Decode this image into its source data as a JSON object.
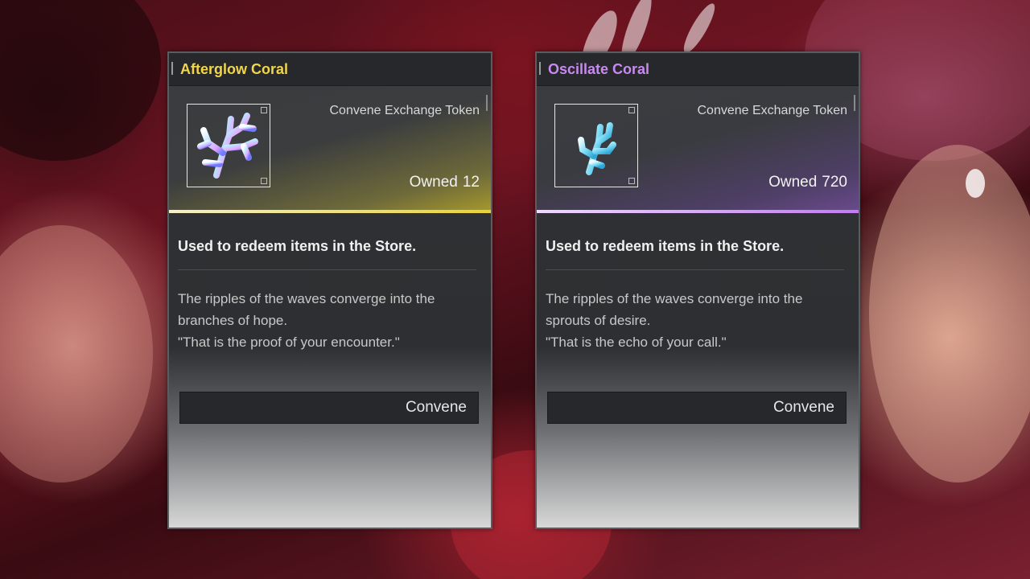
{
  "cards": [
    {
      "title": "Afterglow Coral",
      "title_color": "#f2d64a",
      "accent_color": "#e8d23a",
      "token_label": "Convene Exchange Token",
      "owned_label": "Owned",
      "owned_count": "12",
      "summary": "Used to redeem items in the Store.",
      "lore": [
        "The ripples of the waves converge into the",
        "branches of hope.",
        "\"That is the proof of your encounter.\""
      ],
      "button_label": "Convene",
      "icon": "afterglow-coral-icon"
    },
    {
      "title": "Oscillate Coral",
      "title_color": "#c98af0",
      "accent_color": "#c27cf0",
      "token_label": "Convene Exchange Token",
      "owned_label": "Owned",
      "owned_count": "720",
      "summary": "Used to redeem items in the Store.",
      "lore": [
        "The ripples of the waves converge into the",
        "sprouts of desire.",
        "\"That is the echo of your call.\""
      ],
      "button_label": "Convene",
      "icon": "oscillate-coral-icon"
    }
  ]
}
